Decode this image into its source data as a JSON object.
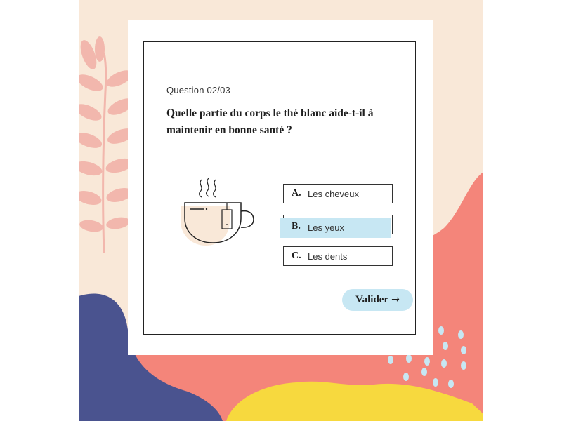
{
  "quiz": {
    "counter": "Question 02/03",
    "question": "Quelle partie du corps le thé blanc aide-t-il à maintenir en bonne santé ?",
    "options": [
      {
        "letter": "A.",
        "text": "Les cheveux",
        "selected": false
      },
      {
        "letter": "B.",
        "text": "Les yeux",
        "selected": true
      },
      {
        "letter": "C.",
        "text": "Les dents",
        "selected": false
      }
    ],
    "submit_label": "Valider",
    "submit_icon": "→"
  },
  "colors": {
    "background": "#f9e8d8",
    "leaf": "#f2b7ad",
    "coral": "#f4857a",
    "navy": "#4a538f",
    "yellow": "#f7d93e",
    "highlight": "#c7e7f3",
    "dots": "#c7e7f3"
  },
  "icons": {
    "illustration": "teacup-icon",
    "submit": "arrow-right-icon"
  }
}
